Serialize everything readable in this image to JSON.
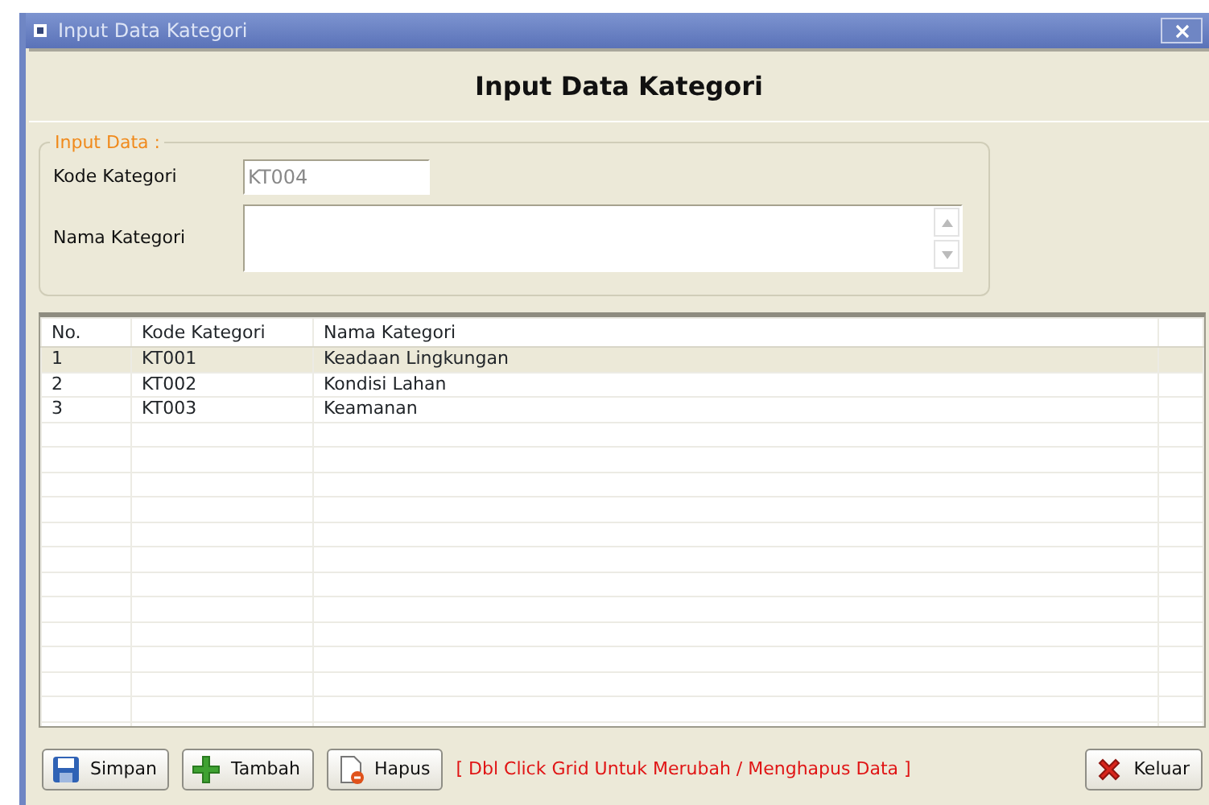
{
  "window": {
    "title": "Input Data Kategori"
  },
  "header": "Input Data Kategori",
  "form": {
    "legend": "Input Data :",
    "fields": [
      {
        "label": "Kode Kategori",
        "value": "KT004",
        "kind": "text",
        "disabled": true
      },
      {
        "label": "Nama Kategori",
        "kind": "memo",
        "disabled": false
      }
    ]
  },
  "table": {
    "columns": [
      "No.",
      "Kode Kategori",
      "Nama Kategori"
    ],
    "rows": [
      {
        "cells": [
          "1",
          "KT001",
          "Keadaan Lingkungan"
        ],
        "selected": true
      },
      {
        "cells": [
          "2",
          "KT002",
          "Kondisi Lahan"
        ],
        "selected": false
      },
      {
        "cells": [
          "3",
          "KT003",
          "Keamanan"
        ],
        "selected": false
      }
    ]
  },
  "buttons": [
    {
      "label": "Simpan",
      "kind": "save"
    },
    {
      "label": "Tambah",
      "kind": "add"
    },
    {
      "label": "Hapus",
      "kind": "delete"
    }
  ],
  "hint": "[ Dbl Click Grid Untuk Merubah / Menghapus Data ]",
  "exit_button": {
    "label": "Keluar",
    "kind": "exit"
  }
}
